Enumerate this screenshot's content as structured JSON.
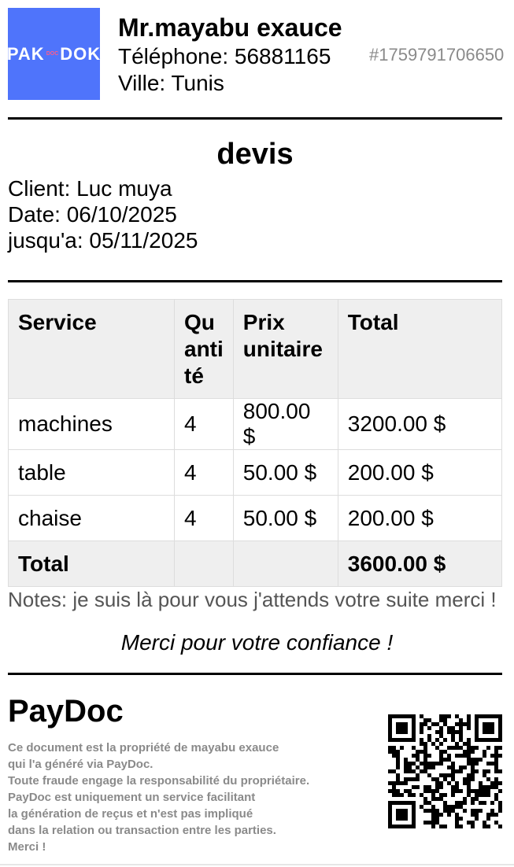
{
  "logo": {
    "left": "PAK",
    "mid": "DOC",
    "right": "DOK"
  },
  "header": {
    "company_name": "Mr.mayabu exauce",
    "phone": "Téléphone: 56881165",
    "city": "Ville: Tunis",
    "doc_number": "#1759791706650"
  },
  "document": {
    "title": "devis",
    "client": "Client: Luc muya",
    "date": "Date: 06/10/2025",
    "valid_until": "jusqu'a: 05/11/2025"
  },
  "table": {
    "headers": {
      "service": "Service",
      "quantity_1": "Qu",
      "quantity_2": "anti",
      "quantity_3": "té",
      "unit_price_1": "Prix",
      "unit_price_2": "unitaire",
      "total": "Total"
    },
    "rows": [
      {
        "service": "machines",
        "quantity": "4",
        "unit_price": "800.00 $",
        "total": "3200.00 $"
      },
      {
        "service": "table",
        "quantity": "4",
        "unit_price": "50.00 $",
        "total": "200.00 $"
      },
      {
        "service": "chaise",
        "quantity": "4",
        "unit_price": "50.00 $",
        "total": "200.00 $"
      }
    ],
    "total_label": "Total",
    "grand_total": "3600.00 $"
  },
  "notes": "Notes: je suis là pour vous j'attends votre suite merci !",
  "thanks": "Merci pour votre confiance !",
  "footer": {
    "brand": "PayDoc",
    "disclaimer": [
      "Ce document est la propriété de mayabu exauce",
      "qui l'a généré via PayDoc.",
      "Toute fraude engage la responsabilité du propriétaire.",
      "PayDoc est uniquement un service facilitant",
      "la génération de reçus et n'est pas impliqué",
      "dans la relation ou transaction entre les parties.",
      "Merci !"
    ]
  },
  "colors": {
    "logo_bg": "#4f74fb",
    "table_header_bg": "#efefef",
    "muted_text": "#8a8a8a"
  }
}
